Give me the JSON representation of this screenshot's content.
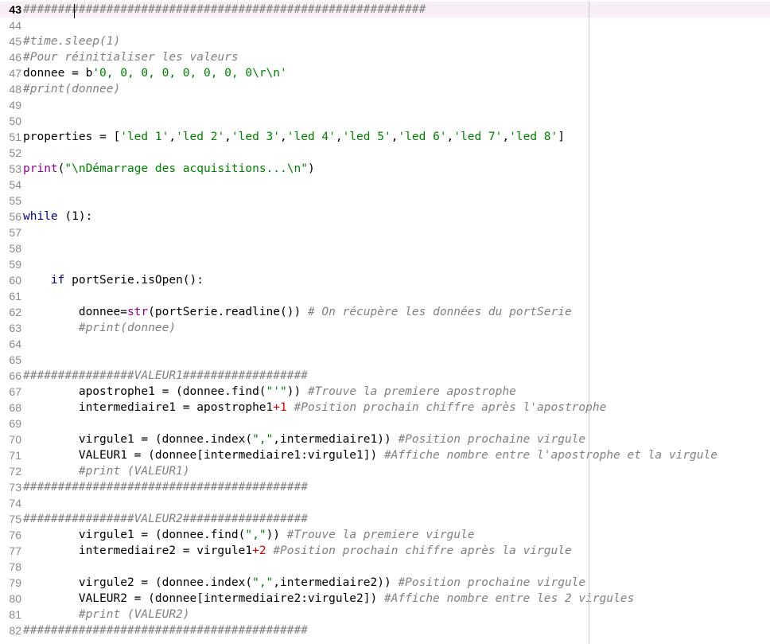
{
  "editor": {
    "current_line": "43",
    "lines": [
      {
        "no": "43",
        "tokens": [
          {
            "t": "##########################################################",
            "k": "cmt"
          }
        ]
      },
      {
        "no": "44",
        "tokens": []
      },
      {
        "no": "45",
        "tokens": [
          {
            "t": "#time.sleep(1)",
            "k": "cmt"
          }
        ]
      },
      {
        "no": "46",
        "tokens": [
          {
            "t": "#Pour réinitialiser les valeurs",
            "k": "cmt"
          }
        ]
      },
      {
        "no": "47",
        "tokens": [
          {
            "t": "donnee = b",
            "k": "op"
          },
          {
            "t": "'0, 0, 0, 0, 0, 0, 0, 0\\r\\n'",
            "k": "str"
          }
        ]
      },
      {
        "no": "48",
        "tokens": [
          {
            "t": "#print(donnee)",
            "k": "cmt"
          }
        ]
      },
      {
        "no": "49",
        "tokens": []
      },
      {
        "no": "50",
        "tokens": []
      },
      {
        "no": "51",
        "tokens": [
          {
            "t": "properties = [",
            "k": "op"
          },
          {
            "t": "'led 1'",
            "k": "str"
          },
          {
            "t": ",",
            "k": "op"
          },
          {
            "t": "'led 2'",
            "k": "str"
          },
          {
            "t": ",",
            "k": "op"
          },
          {
            "t": "'led 3'",
            "k": "str"
          },
          {
            "t": ",",
            "k": "op"
          },
          {
            "t": "'led 4'",
            "k": "str"
          },
          {
            "t": ",",
            "k": "op"
          },
          {
            "t": "'led 5'",
            "k": "str"
          },
          {
            "t": ",",
            "k": "op"
          },
          {
            "t": "'led 6'",
            "k": "str"
          },
          {
            "t": ",",
            "k": "op"
          },
          {
            "t": "'led 7'",
            "k": "str"
          },
          {
            "t": ",",
            "k": "op"
          },
          {
            "t": "'led 8'",
            "k": "str"
          },
          {
            "t": "]",
            "k": "op"
          }
        ]
      },
      {
        "no": "52",
        "tokens": []
      },
      {
        "no": "53",
        "tokens": [
          {
            "t": "print",
            "k": "blt"
          },
          {
            "t": "(",
            "k": "op"
          },
          {
            "t": "\"\\nDémarrage des acquisitions...\\n\"",
            "k": "str"
          },
          {
            "t": ")",
            "k": "op"
          }
        ]
      },
      {
        "no": "54",
        "tokens": []
      },
      {
        "no": "55",
        "tokens": []
      },
      {
        "no": "56",
        "tokens": [
          {
            "t": "while",
            "k": "kw"
          },
          {
            "t": " (",
            "k": "op"
          },
          {
            "t": "1",
            "k": "num"
          },
          {
            "t": "):",
            "k": "op"
          }
        ]
      },
      {
        "no": "57",
        "tokens": []
      },
      {
        "no": "58",
        "tokens": []
      },
      {
        "no": "59",
        "tokens": []
      },
      {
        "no": "60",
        "tokens": [
          {
            "t": "    ",
            "k": "op"
          },
          {
            "t": "if",
            "k": "kw"
          },
          {
            "t": " portSerie.isOpen():",
            "k": "op"
          }
        ]
      },
      {
        "no": "61",
        "tokens": []
      },
      {
        "no": "62",
        "tokens": [
          {
            "t": "        donnee=",
            "k": "op"
          },
          {
            "t": "str",
            "k": "blt"
          },
          {
            "t": "(portSerie.readline()) ",
            "k": "op"
          },
          {
            "t": "# On récupère les données du portSerie",
            "k": "cmt"
          }
        ]
      },
      {
        "no": "63",
        "tokens": [
          {
            "t": "        ",
            "k": "op"
          },
          {
            "t": "#print(donnee)",
            "k": "cmt"
          }
        ]
      },
      {
        "no": "64",
        "tokens": []
      },
      {
        "no": "65",
        "tokens": []
      },
      {
        "no": "66",
        "tokens": [
          {
            "t": "################VALEUR1##################",
            "k": "cmt"
          }
        ]
      },
      {
        "no": "67",
        "tokens": [
          {
            "t": "        apostrophe1 = (donnee.find(",
            "k": "op"
          },
          {
            "t": "\"'\"",
            "k": "str"
          },
          {
            "t": ")) ",
            "k": "op"
          },
          {
            "t": "#Trouve la premiere apostrophe",
            "k": "cmt"
          }
        ]
      },
      {
        "no": "68",
        "tokens": [
          {
            "t": "        intermediaire1 = apostrophe1",
            "k": "op"
          },
          {
            "t": "+1",
            "k": "red"
          },
          {
            "t": " ",
            "k": "op"
          },
          {
            "t": "#Position prochain chiffre après l'apostrophe",
            "k": "cmt"
          }
        ]
      },
      {
        "no": "69",
        "tokens": []
      },
      {
        "no": "70",
        "tokens": [
          {
            "t": "        virgule1 = (donnee.index(",
            "k": "op"
          },
          {
            "t": "\",\"",
            "k": "str"
          },
          {
            "t": ",intermediaire1)) ",
            "k": "op"
          },
          {
            "t": "#Position prochaine virgule",
            "k": "cmt"
          }
        ]
      },
      {
        "no": "71",
        "tokens": [
          {
            "t": "        VALEUR1 = (donnee[intermediaire1:virgule1]) ",
            "k": "op"
          },
          {
            "t": "#Affiche nombre entre l'apostrophe et la virgule",
            "k": "cmt"
          }
        ]
      },
      {
        "no": "72",
        "tokens": [
          {
            "t": "        ",
            "k": "op"
          },
          {
            "t": "#print (VALEUR1)",
            "k": "cmt"
          }
        ]
      },
      {
        "no": "73",
        "tokens": [
          {
            "t": "#########################################",
            "k": "cmt"
          }
        ]
      },
      {
        "no": "74",
        "tokens": []
      },
      {
        "no": "75",
        "tokens": [
          {
            "t": "################VALEUR2##################",
            "k": "cmt"
          }
        ]
      },
      {
        "no": "76",
        "tokens": [
          {
            "t": "        virgule1 = (donnee.find(",
            "k": "op"
          },
          {
            "t": "\",\"",
            "k": "str"
          },
          {
            "t": ")) ",
            "k": "op"
          },
          {
            "t": "#Trouve la premiere virgule",
            "k": "cmt"
          }
        ]
      },
      {
        "no": "77",
        "tokens": [
          {
            "t": "        intermediaire2 = virgule1",
            "k": "op"
          },
          {
            "t": "+2",
            "k": "red"
          },
          {
            "t": " ",
            "k": "op"
          },
          {
            "t": "#Position prochain chiffre après la virgule",
            "k": "cmt"
          }
        ]
      },
      {
        "no": "78",
        "tokens": []
      },
      {
        "no": "79",
        "tokens": [
          {
            "t": "        virgule2 = (donnee.index(",
            "k": "op"
          },
          {
            "t": "\",\"",
            "k": "str"
          },
          {
            "t": ",intermediaire2)) ",
            "k": "op"
          },
          {
            "t": "#Position prochaine virgule",
            "k": "cmt"
          }
        ]
      },
      {
        "no": "80",
        "tokens": [
          {
            "t": "        VALEUR2 = (donnee[intermediaire2:virgule2]) ",
            "k": "op"
          },
          {
            "t": "#Affiche nombre entre les 2 virgules",
            "k": "cmt"
          }
        ]
      },
      {
        "no": "81",
        "tokens": [
          {
            "t": "        ",
            "k": "op"
          },
          {
            "t": "#print (VALEUR2)",
            "k": "cmt"
          }
        ]
      },
      {
        "no": "82",
        "tokens": [
          {
            "t": "#########################################",
            "k": "cmt"
          }
        ]
      }
    ]
  },
  "colors": {
    "keyword": "#000080",
    "string": "#008000",
    "comment": "#808080",
    "builtin": "#900090",
    "number_operator": "#d40000",
    "current_line_bg": "#f8eef6"
  }
}
